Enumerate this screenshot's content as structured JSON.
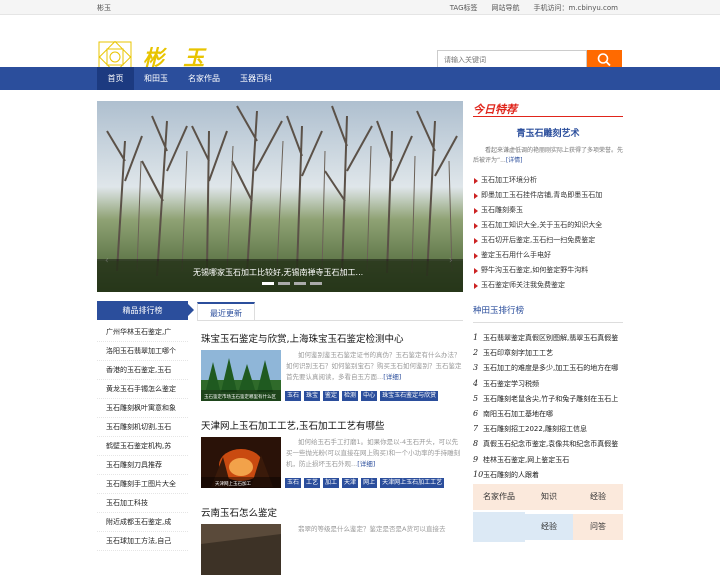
{
  "topbar": {
    "site_name": "彬玉",
    "links": [
      "TAG标签",
      "网站导航",
      "手机访问：",
      "m.cbinyu.com"
    ]
  },
  "header": {
    "logo_text": "彬 玉",
    "search_placeholder": "请输入关键词"
  },
  "nav": {
    "items": [
      "首页",
      "和田玉",
      "名家作品",
      "玉器百科"
    ],
    "active": "首页"
  },
  "slider": {
    "caption": "无锡哪家玉石加工比较好,无锡南禅寺玉石加工..."
  },
  "today": {
    "title": "今日特荐",
    "headline": "青玉石雕刻艺术",
    "desc": "看起来谦虚低调的艳丽刚实际上获得了多项荣誉。先后被评为“...",
    "more": "[详情]",
    "items": [
      "玉石加工环境分析",
      "即墨加工玉石挂件店铺,青岛即墨玉石加",
      "玉石雕刻秦玉",
      "玉石加工知识大全,关于玉石的知识大全",
      "玉石切开后鉴定,玉石扫一扫免费鉴定",
      "鉴定玉石用什么手电好",
      "野牛沟玉石鉴定,如何鉴定野牛沟料",
      "玉石鉴定师关注我免费鉴定"
    ]
  },
  "left": {
    "title": "精品排行榜",
    "items": [
      "广州华林玉石鉴定,广",
      "洛阳玉石翡翠加工哪个",
      "香港的玉石鉴定,玉石",
      "黄龙玉石手镯怎么鉴定",
      "玉石雕刻枫叶寓意和象",
      "玉石雕刻机切割,玉石",
      "鹤壁玉石鉴定机构,苏",
      "玉石雕刻刀具推荐",
      "玉石雕刻手工图片大全",
      "玉石加工科技",
      "附近成都玉石鉴定,成",
      "玉石球加工方法,自己"
    ]
  },
  "center": {
    "tab": "最近更新",
    "articles": [
      {
        "title": "珠宝玉石鉴定与欣赏,上海珠宝玉石鉴定检测中心",
        "thumb_caption": "玉石鉴定市场玉石鉴定哪里有什么区",
        "desc": "如何鉴别鉴玉石鉴定证书的真伪？玉石鉴定有什么办法？如何识别玉石？如何鉴别宝石？购买玉石如何鉴别？玉石鉴定首先要认真阅读，多看自玉方面...",
        "more": "[详细]",
        "tags": [
          "玉石",
          "珠宝",
          "鉴定",
          "检测",
          "中心",
          "珠宝玉石鉴定与欣赏"
        ]
      },
      {
        "title": "天津网上玉石加工工艺,玉石加工工艺有哪些",
        "thumb_caption": "天津网上玉石加工",
        "desc": "如何给玉石手工打磨1。如果你是以-4玉石开头，可以先买一些抛光粉(可以直接在网上购买)和一个小功率的手持雕刻机，防止损坏玉石外观...",
        "more": "[详细]",
        "tags": [
          "玉石",
          "工艺",
          "加工",
          "天津",
          "网上",
          "天津网上玉石加工工艺"
        ]
      },
      {
        "title": "云南玉石怎么鉴定",
        "thumb_caption": "",
        "desc": "翡翠的等级是什么鉴定？鉴定是否是A货可以直接去",
        "more": "",
        "tags": []
      }
    ]
  },
  "right": {
    "rank_title": "种田玉排行榜",
    "items": [
      "玉石翡翠鉴定真假区别图解,翡翠玉石真假鉴",
      "玉石印章刻字加工工艺",
      "玉石加工的难度是多少,加工玉石的地方在哪",
      "玉石鉴定学习税频",
      "玉石雕刻老鼠含尖,竹子和兔子雕刻在玉石上",
      "南阳玉石加工基地在哪",
      "玉石雕刻招工2022,雕刻招工信息",
      "真假玉石纪念币鉴定,袁像共和纪念币真假鉴",
      "桂林玉石鉴定,网上鉴定玉石",
      "玉石雕刻的人跟着"
    ],
    "categories": [
      "名家作品",
      "知识",
      "经验",
      "",
      "经验",
      "问答"
    ]
  },
  "colors": {
    "nav": "#2b4e9c",
    "accent": "#ff6a00",
    "logo": "#e8c400",
    "red": "#e0251b"
  }
}
